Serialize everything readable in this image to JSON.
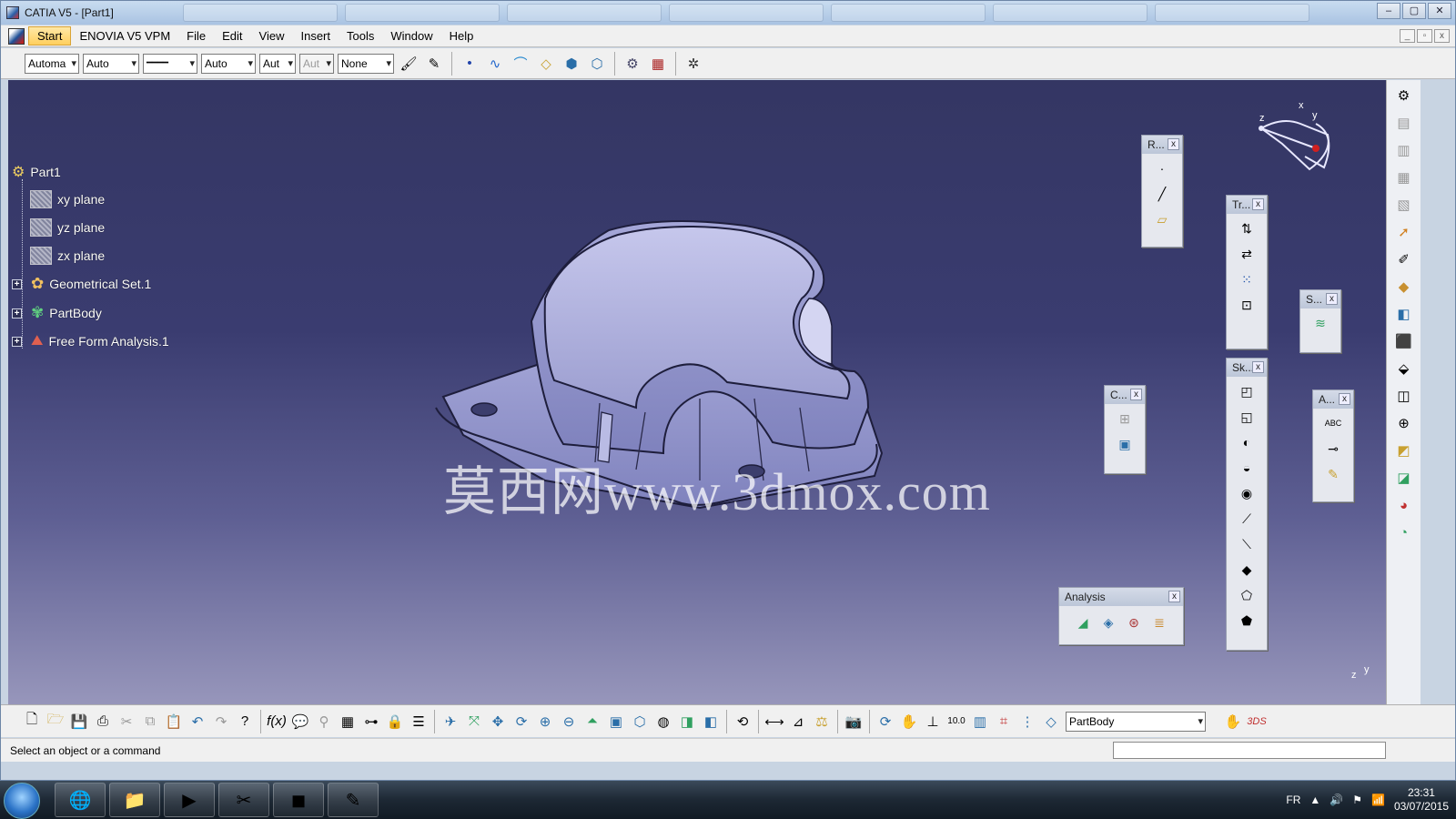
{
  "window": {
    "title": "CATIA V5 - [Part1]",
    "controls": [
      "–",
      "▢",
      "✕"
    ]
  },
  "menu": {
    "items": [
      "Start",
      "ENOVIA V5 VPM",
      "File",
      "Edit",
      "View",
      "Insert",
      "Tools",
      "Window",
      "Help"
    ]
  },
  "toolbar1": {
    "combos": [
      {
        "value": "Automa",
        "disabled": false
      },
      {
        "value": "Auto",
        "disabled": false
      },
      {
        "value": "━━━━",
        "disabled": false
      },
      {
        "value": "Auto",
        "disabled": false
      },
      {
        "value": "Aut",
        "disabled": false
      },
      {
        "value": "Aut",
        "disabled": true
      },
      {
        "value": "None",
        "disabled": false
      }
    ]
  },
  "tree": {
    "root": "Part1",
    "items": [
      {
        "label": "xy plane",
        "icon": "plane-icon",
        "expandable": false
      },
      {
        "label": "yz plane",
        "icon": "plane-icon",
        "expandable": false
      },
      {
        "label": "zx plane",
        "icon": "plane-icon",
        "expandable": false
      },
      {
        "label": "Geometrical Set.1",
        "icon": "geometrical-set-icon",
        "expandable": true
      },
      {
        "label": "PartBody",
        "icon": "partbody-icon",
        "expandable": true
      },
      {
        "label": "Free Form Analysis.1",
        "icon": "analysis-icon",
        "expandable": true
      }
    ]
  },
  "watermark": "莫西网www.3dmox.com",
  "palettes": {
    "r": {
      "title": "R..."
    },
    "tr": {
      "title": "Tr..."
    },
    "s": {
      "title": "S..."
    },
    "sk": {
      "title": "Sk..."
    },
    "c": {
      "title": "C..."
    },
    "a": {
      "title": "A..."
    },
    "analysis": {
      "title": "Analysis"
    }
  },
  "compass": {
    "x": "x",
    "y": "y",
    "z": "z"
  },
  "axis_small": {
    "z": "z",
    "y": "y",
    "x": "x"
  },
  "bottom_toolbar": {
    "current_body": "PartBody"
  },
  "status": {
    "text": "Select an object or a command",
    "command_value": ""
  },
  "taskbar": {
    "language": "FR",
    "time": "23:31",
    "date": "03/07/2015"
  },
  "colors": {
    "viewport_top": "#343663",
    "viewport_bottom": "#9796bb",
    "part_fill": "#a9abd6"
  }
}
